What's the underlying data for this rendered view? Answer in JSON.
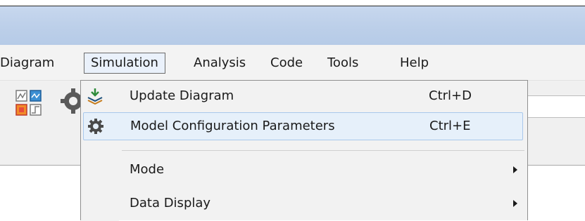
{
  "menu_bar": {
    "items": [
      {
        "label": "Diagram"
      },
      {
        "label": "Simulation"
      },
      {
        "label": "Analysis"
      },
      {
        "label": "Code"
      },
      {
        "label": "Tools"
      },
      {
        "label": "Help"
      }
    ],
    "open_menu": "Simulation"
  },
  "dropdown": {
    "items": [
      {
        "label": "Update Diagram",
        "shortcut": "Ctrl+D",
        "icon": "update-diagram-icon"
      },
      {
        "label": "Model Configuration Parameters",
        "shortcut": "Ctrl+E",
        "icon": "gear-icon"
      },
      {
        "label": "Mode",
        "icon": "submenu-arrow-icon"
      },
      {
        "label": "Data Display",
        "icon": "submenu-arrow-icon"
      }
    ]
  },
  "colors": {
    "title_bar": "#bccfe9",
    "menu_bar": "#f3f3f3",
    "menu_hover": "#e6f0fa",
    "menu_hover_border": "#a9c8ec"
  }
}
